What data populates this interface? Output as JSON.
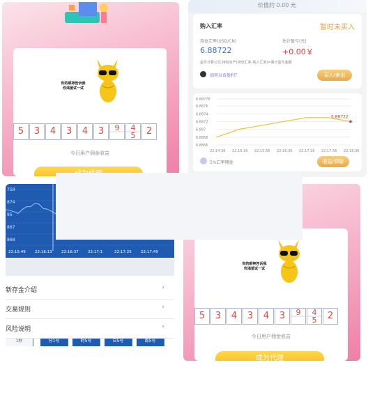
{
  "colors": {
    "accent_gold": "#f6b91b",
    "pink": "#ef7fa6",
    "chart_blue": "#1f5bb0",
    "red": "#e33333",
    "blue_value": "#3d6fd0"
  },
  "promo": {
    "mascot_text_line1": "你的眼神告诉我",
    "mascot_text_line2": "你渴望试一试",
    "digits": [
      "5",
      "3",
      "4",
      "3",
      "4",
      "3"
    ],
    "split_digits": [
      [
        "",
        "9"
      ],
      [
        "4",
        "5"
      ]
    ],
    "last_digit": "2",
    "note": "今日用户佣金收益",
    "agent_button": "成为代理"
  },
  "exchange": {
    "top_text": "价值约 0.00 元",
    "buy_rate_label": "购入汇率",
    "status": "暂时未买入",
    "holding_rate_label": "持仓汇率(USD/CN)",
    "holding_rate_value": "6.88722",
    "pnl_label": "估计盈亏(元)",
    "pnl_value": "+0.00￥",
    "formula": "盈亏计算公式:持有资产(持仓汇率-购入汇率)=累计盈亏金额",
    "how_to_profit": "如何以合盈利？",
    "buy_button": "买入/卖出",
    "rate_footer": "5%汇率佣金",
    "collect_button": "收益/领取"
  },
  "chart_data": {
    "type": "line",
    "title": "",
    "x": [
      "22:14:36",
      "22:15:16",
      "22:15:56",
      "22:16:36",
      "22:17:16",
      "22:17:56",
      "22:18:36"
    ],
    "series": [
      {
        "values": [
          6.8868,
          6.887,
          6.8871,
          6.8872,
          6.8873,
          6.8873,
          6.8872
        ]
      }
    ],
    "yticks": [
      "6.88778",
      "6.8876",
      "6.8874",
      "6.8872",
      "6.887",
      "6.8868",
      "6.8866"
    ],
    "last_value_label": "6.88722",
    "ylim": [
      6.8866,
      6.88778
    ],
    "grid": true
  },
  "dark_chart": {
    "y_labels": [
      "758",
      "874",
      "95",
      "867",
      "868"
    ],
    "x_labels": [
      "22:15:49",
      "22:16:13",
      "22:16:37",
      "22:17:1",
      "22:17:25",
      "22:17:49"
    ],
    "segments": [
      "1秒",
      "分1号",
      "时5号",
      "日5号",
      "周5号"
    ]
  },
  "menu": {
    "items": [
      "新存金介绍",
      "交易规则",
      "风险说明"
    ],
    "chevron": "›"
  }
}
